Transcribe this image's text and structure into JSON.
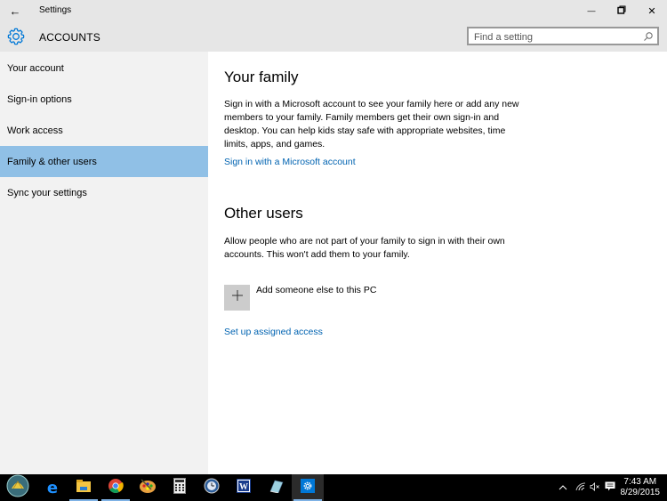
{
  "window": {
    "title": "Settings",
    "back_icon": "←",
    "minimize_icon": "—",
    "maximize_icon": "❐",
    "close_icon": "✕"
  },
  "header": {
    "title": "ACCOUNTS",
    "search_placeholder": "Find a setting"
  },
  "sidebar": {
    "items": [
      {
        "label": "Your account",
        "selected": false
      },
      {
        "label": "Sign-in options",
        "selected": false
      },
      {
        "label": "Work access",
        "selected": false
      },
      {
        "label": "Family & other users",
        "selected": true
      },
      {
        "label": "Sync your settings",
        "selected": false
      }
    ]
  },
  "content": {
    "family": {
      "heading": "Your family",
      "description": "Sign in with a Microsoft account to see your family here or add any new members to your family. Family members get their own sign-in and desktop. You can help kids stay safe with appropriate websites, time limits, apps, and games.",
      "link": "Sign in with a Microsoft account"
    },
    "other_users": {
      "heading": "Other users",
      "description": "Allow people who are not part of your family to sign in with their own accounts. This won't add them to your family.",
      "add_label": "Add someone else to this PC",
      "add_icon": "+",
      "assigned_access_link": "Set up assigned access"
    }
  },
  "taskbar": {
    "apps": [
      "start-button",
      "edge",
      "file-explorer",
      "chrome",
      "paint",
      "calculator",
      "clock-app",
      "word",
      "notepad",
      "settings"
    ],
    "tray": {
      "chevron": "^",
      "time": "7:43 AM",
      "date": "8/29/2015"
    }
  },
  "colors": {
    "accent": "#0063b1",
    "selected_nav": "#90c0e6",
    "header_bg": "#e6e6e6",
    "sidebar_bg": "#f2f2f2"
  }
}
